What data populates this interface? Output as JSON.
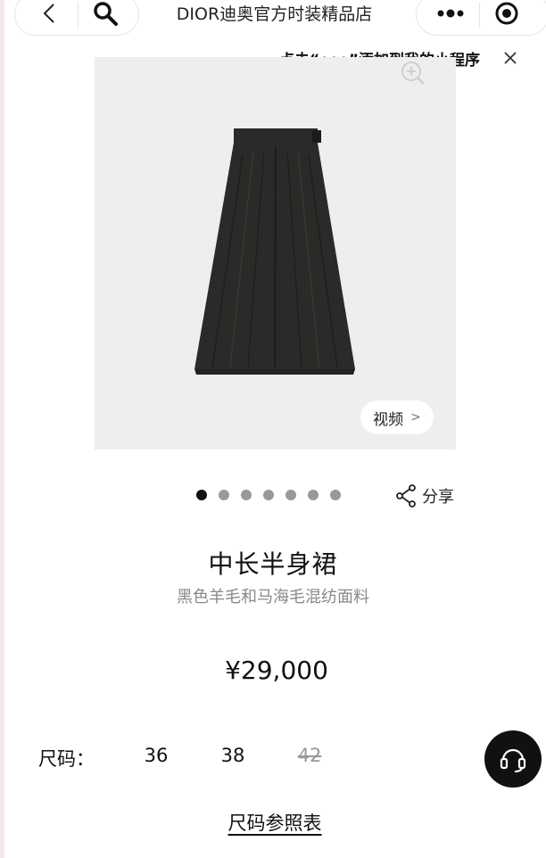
{
  "header": {
    "title": "DIOR迪奥官方时装精品店"
  },
  "tooltip": {
    "text": "点击“•••”添加到我的小程序"
  },
  "product": {
    "video_label": "视频",
    "carousel_total": 7,
    "carousel_active": 1,
    "share_label": "分享",
    "name": "中长半身裙",
    "description": "黑色羊毛和马海毛混纺面料",
    "price": "¥29,000"
  },
  "sizes": {
    "label": "尺码：",
    "options": [
      {
        "value": "36",
        "available": true
      },
      {
        "value": "38",
        "available": true
      },
      {
        "value": "42",
        "available": false
      }
    ],
    "guide_label": "尺码参照表"
  },
  "colors": {
    "skirt": "#2b2a28",
    "image_bg": "#eeeeee",
    "service_bg": "#111111"
  }
}
